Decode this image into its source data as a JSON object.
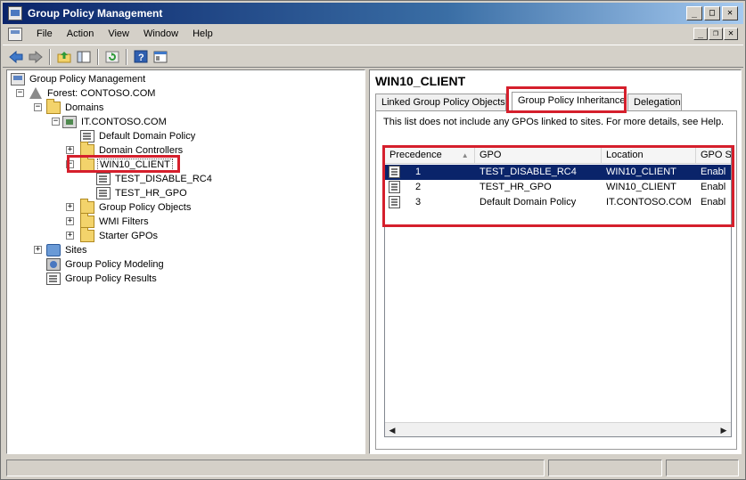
{
  "window": {
    "title": "Group Policy Management"
  },
  "menu": {
    "items": [
      "File",
      "Action",
      "View",
      "Window",
      "Help"
    ]
  },
  "toolbar": {
    "buttons": [
      "back-icon",
      "forward-icon",
      "up-folder-icon",
      "show-hide-tree-icon",
      "refresh-icon",
      "help-icon",
      "properties-icon"
    ]
  },
  "tree": {
    "root": "Group Policy Management",
    "forest": "Forest: CONTOSO.COM",
    "domains": "Domains",
    "domain": "IT.CONTOSO.COM",
    "default_policy": "Default Domain Policy",
    "domain_controllers": "Domain Controllers",
    "selected_ou": "WIN10_CLIENT",
    "link1": "TEST_DISABLE_RC4",
    "link2": "TEST_HR_GPO",
    "gpo_objects": "Group Policy Objects",
    "wmi_filters": "WMI Filters",
    "starter_gpos": "Starter GPOs",
    "sites": "Sites",
    "modeling": "Group Policy Modeling",
    "results": "Group Policy Results"
  },
  "details": {
    "title": "WIN10_CLIENT",
    "tabs": [
      "Linked Group Policy Objects",
      "Group Policy Inheritance",
      "Delegation"
    ],
    "info": "This list does not include any GPOs linked to sites. For more details, see Help.",
    "columns": [
      "Precedence",
      "GPO",
      "Location",
      "GPO S"
    ],
    "rows": [
      {
        "precedence": "1",
        "gpo": "TEST_DISABLE_RC4",
        "location": "WIN10_CLIENT",
        "status": "Enabl"
      },
      {
        "precedence": "2",
        "gpo": "TEST_HR_GPO",
        "location": "WIN10_CLIENT",
        "status": "Enabl"
      },
      {
        "precedence": "3",
        "gpo": "Default Domain Policy",
        "location": "IT.CONTOSO.COM",
        "status": "Enabl"
      }
    ]
  },
  "colors": {
    "highlight": "#d51f2c",
    "selection": "#0a246a",
    "titlebar": "#0a246a"
  }
}
